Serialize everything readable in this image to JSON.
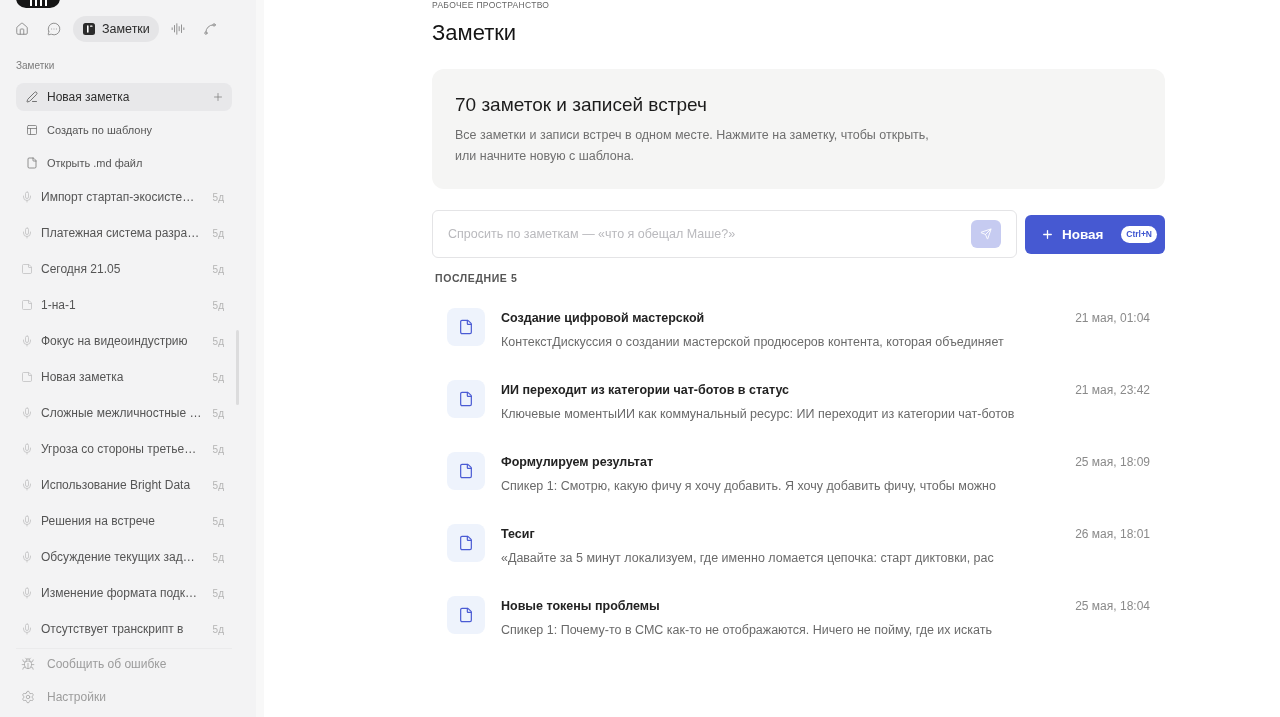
{
  "sidebar": {
    "nav_tabs": [
      {
        "selected": false
      },
      {
        "selected": false
      },
      {
        "label": "Заметки",
        "selected": true
      },
      {
        "selected": false
      },
      {
        "selected": false
      }
    ],
    "section_label": "Заметки",
    "actions": [
      {
        "kind": "new",
        "label": "Новая заметка"
      },
      {
        "kind": "template",
        "label": "Создать по шаблону"
      },
      {
        "kind": "open",
        "label": "Открыть .md файл"
      }
    ],
    "notes": [
      {
        "kind": "recording",
        "title": "Импорт стартап-экосисте…",
        "age": "5д"
      },
      {
        "kind": "recording",
        "title": "Платежная система разра…",
        "age": "5д"
      },
      {
        "kind": "note",
        "title": "Сегодня 21.05",
        "age": "5д"
      },
      {
        "kind": "note",
        "title": "1-на-1",
        "age": "5д"
      },
      {
        "kind": "recording",
        "title": "Фокус на видеоиндустрию",
        "age": "5д"
      },
      {
        "kind": "note",
        "title": "Новая заметка",
        "age": "5д"
      },
      {
        "kind": "recording",
        "title": "Сложные межличностные …",
        "age": "5д"
      },
      {
        "kind": "recording",
        "title": "Угроза со стороны третье…",
        "age": "5д"
      },
      {
        "kind": "recording",
        "title": "Использование Bright Data",
        "age": "5д"
      },
      {
        "kind": "recording",
        "title": "Решения на встрече",
        "age": "5д"
      },
      {
        "kind": "recording",
        "title": "Обсуждение текущих зад…",
        "age": "5д"
      },
      {
        "kind": "recording",
        "title": "Изменение формата подк…",
        "age": "5д"
      },
      {
        "kind": "recording",
        "title": "Отсутствует транскрипт в",
        "age": "5д"
      }
    ],
    "footer": [
      {
        "kind": "bug",
        "label": "Сообщить об ошибке"
      },
      {
        "kind": "settings",
        "label": "Настройки"
      }
    ]
  },
  "main": {
    "overline": "РАБОЧЕЕ ПРОСТРАНСТВО",
    "title": "Заметки",
    "summary": {
      "heading": "70 заметок и записей встреч",
      "description": "Все заметки и записи встреч в одном месте. Нажмите на заметку, чтобы открыть, или начните новую с шаблона."
    },
    "ask": {
      "placeholder": "Спросить по заметкам — «что я обещал Маше?»"
    },
    "new_button": {
      "label": "Новая",
      "shortcut": "Ctrl+N"
    },
    "recent": {
      "heading": "ПОСЛЕДНИЕ 5",
      "items": [
        {
          "title": "Создание цифровой мастерской",
          "date": "21 мая, 01:04",
          "snippet": "КонтекстДискуссия о создании мастерской продюсеров контента, которая объединяет"
        },
        {
          "title": "ИИ переходит из категории чат-ботов в статус",
          "date": "21 мая, 23:42",
          "snippet": "Ключевые моментыИИ как коммунальный ресурс: ИИ переходит из категории чат-ботов"
        },
        {
          "title": "Формулируем результат",
          "date": "25 мая, 18:09",
          "snippet": "Спикер 1: Смотрю, какую фичу я хочу добавить. Я хочу добавить фичу, чтобы можно"
        },
        {
          "title": "Тесиг",
          "date": "26 мая, 18:01",
          "snippet": "«Давайте за 5 минут локализуем, где именно ломается цепочка: старт диктовки, рас"
        },
        {
          "title": "Новые токены проблемы",
          "date": "25 мая, 18:04",
          "snippet": "Спикер 1: Почему-то в СМС как-то не отображаются. Ничего не пойму, где их искать"
        }
      ]
    }
  }
}
